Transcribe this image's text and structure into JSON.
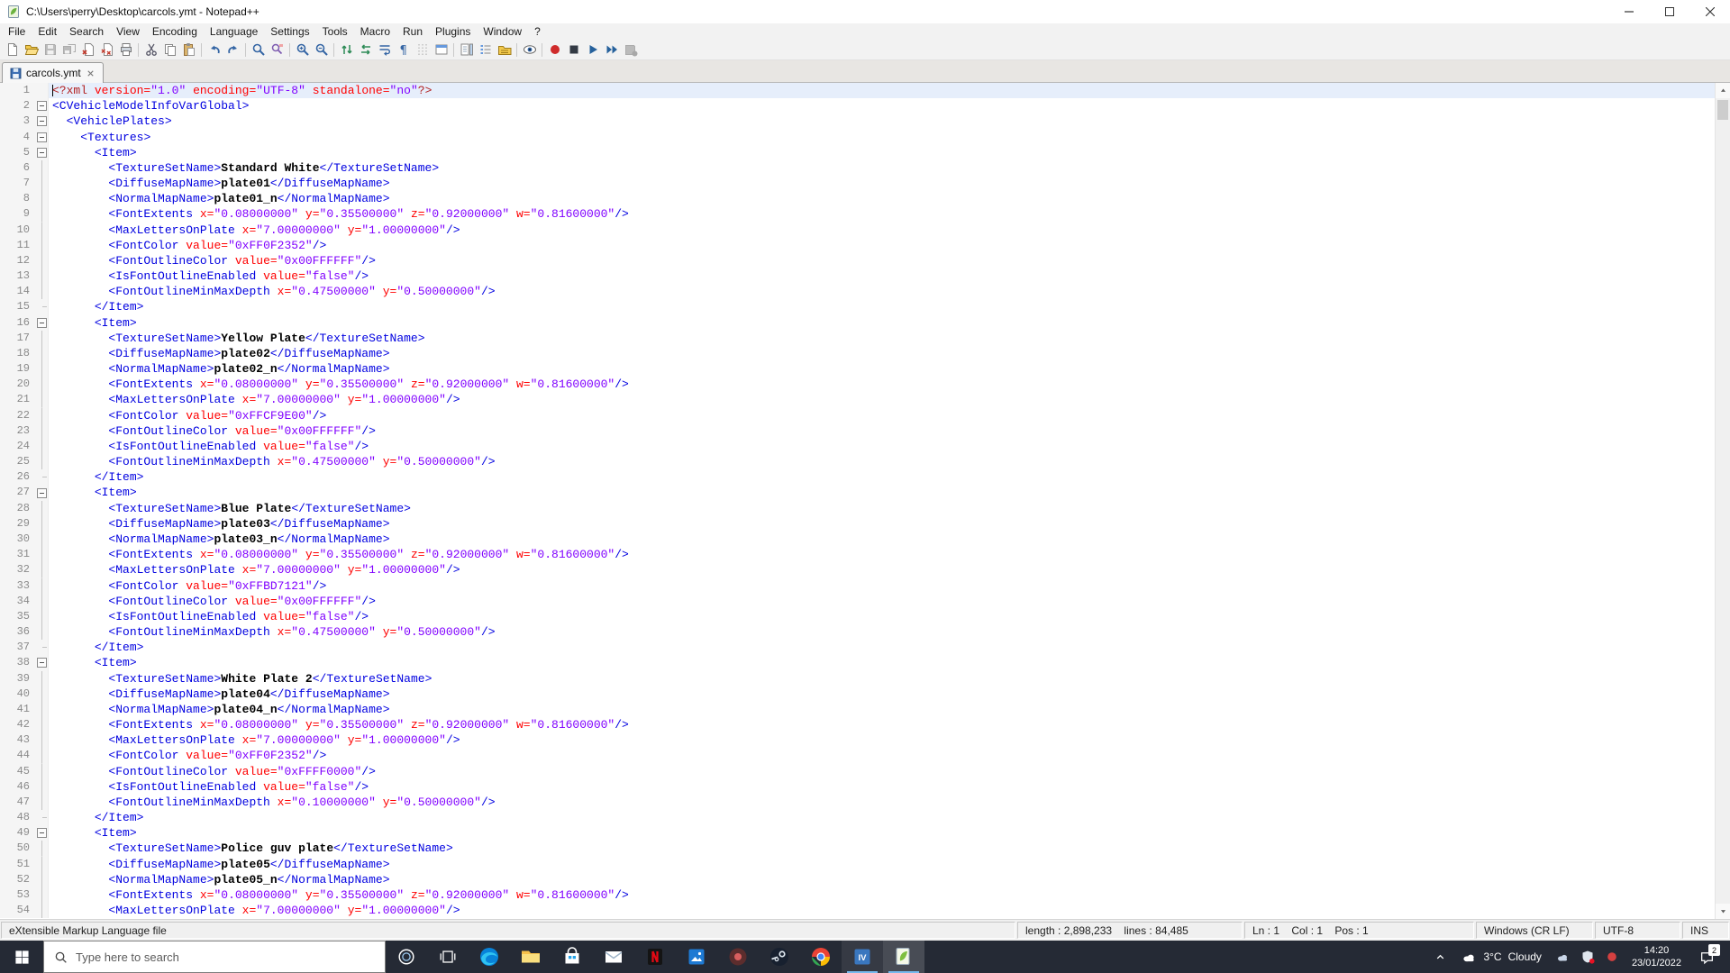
{
  "window": {
    "title": "C:\\Users\\perry\\Desktop\\carcols.ymt - Notepad++"
  },
  "menu": {
    "items": [
      "File",
      "Edit",
      "Search",
      "View",
      "Encoding",
      "Language",
      "Settings",
      "Tools",
      "Macro",
      "Run",
      "Plugins",
      "Window",
      "?"
    ]
  },
  "toolbar": {
    "items": [
      {
        "icon": "new-file",
        "name": "New"
      },
      {
        "icon": "open-folder",
        "name": "Open"
      },
      {
        "icon": "save",
        "name": "Save",
        "disabled": true
      },
      {
        "icon": "save-all",
        "name": "Save All",
        "disabled": true
      },
      {
        "icon": "close-file",
        "name": "Close"
      },
      {
        "icon": "close-all",
        "name": "Close All"
      },
      {
        "icon": "print",
        "name": "Print"
      },
      {
        "sep": true
      },
      {
        "icon": "cut",
        "name": "Cut"
      },
      {
        "icon": "copy",
        "name": "Copy"
      },
      {
        "icon": "paste",
        "name": "Paste"
      },
      {
        "sep": true
      },
      {
        "icon": "undo",
        "name": "Undo"
      },
      {
        "icon": "redo",
        "name": "Redo"
      },
      {
        "sep": true
      },
      {
        "icon": "find",
        "name": "Find"
      },
      {
        "icon": "replace",
        "name": "Replace"
      },
      {
        "sep": true
      },
      {
        "icon": "zoom-in",
        "name": "Zoom In"
      },
      {
        "icon": "zoom-out",
        "name": "Zoom Out"
      },
      {
        "sep": true
      },
      {
        "icon": "sync-v",
        "name": "Synchronize Vertical Scrolling"
      },
      {
        "icon": "sync-h",
        "name": "Synchronize Horizontal Scrolling"
      },
      {
        "icon": "word-wrap",
        "name": "Word Wrap"
      },
      {
        "icon": "show-all-chars",
        "name": "Show All Characters"
      },
      {
        "icon": "indent-guide",
        "name": "Show Indent Guide"
      },
      {
        "icon": "user-dialog",
        "name": "User-Defined Dialog"
      },
      {
        "sep": true
      },
      {
        "icon": "doc-map",
        "name": "Document Map"
      },
      {
        "icon": "function-list",
        "name": "Function List"
      },
      {
        "icon": "folder-workspace",
        "name": "Folder as Workspace"
      },
      {
        "sep": true
      },
      {
        "icon": "monitoring",
        "name": "Monitoring"
      },
      {
        "sep": true
      },
      {
        "icon": "macro-record",
        "name": "Start Recording"
      },
      {
        "icon": "macro-stop",
        "name": "Stop Recording"
      },
      {
        "icon": "macro-play",
        "name": "Playback"
      },
      {
        "icon": "macro-run-multiple",
        "name": "Run Macro Multiple Times"
      },
      {
        "icon": "macro-save",
        "name": "Save Recorded Macro",
        "disabled": true
      }
    ]
  },
  "tabs": [
    {
      "label": "carcols.ymt",
      "active": true,
      "saved": true
    }
  ],
  "editor": {
    "current_line": 1,
    "colors": {
      "tag": "#0000E0",
      "attr": "#FF0000",
      "value": "#8000FF",
      "pi": "#B22222",
      "text": "#000000",
      "current_line_bg": "#E6EEFB"
    },
    "fold_boxes": [
      2,
      3,
      4,
      5,
      16,
      27,
      38,
      49
    ],
    "fold_ends": [
      15,
      26,
      37,
      48
    ],
    "lines": [
      "<?xml version=\"1.0\" encoding=\"UTF-8\" standalone=\"no\"?>",
      "<CVehicleModelInfoVarGlobal>",
      "  <VehiclePlates>",
      "    <Textures>",
      "      <Item>",
      "        <TextureSetName>Standard White</TextureSetName>",
      "        <DiffuseMapName>plate01</DiffuseMapName>",
      "        <NormalMapName>plate01_n</NormalMapName>",
      "        <FontExtents x=\"0.08000000\" y=\"0.35500000\" z=\"0.92000000\" w=\"0.81600000\"/>",
      "        <MaxLettersOnPlate x=\"7.00000000\" y=\"1.00000000\"/>",
      "        <FontColor value=\"0xFF0F2352\"/>",
      "        <FontOutlineColor value=\"0x00FFFFFF\"/>",
      "        <IsFontOutlineEnabled value=\"false\"/>",
      "        <FontOutlineMinMaxDepth x=\"0.47500000\" y=\"0.50000000\"/>",
      "      </Item>",
      "      <Item>",
      "        <TextureSetName>Yellow Plate</TextureSetName>",
      "        <DiffuseMapName>plate02</DiffuseMapName>",
      "        <NormalMapName>plate02_n</NormalMapName>",
      "        <FontExtents x=\"0.08000000\" y=\"0.35500000\" z=\"0.92000000\" w=\"0.81600000\"/>",
      "        <MaxLettersOnPlate x=\"7.00000000\" y=\"1.00000000\"/>",
      "        <FontColor value=\"0xFFCF9E00\"/>",
      "        <FontOutlineColor value=\"0x00FFFFFF\"/>",
      "        <IsFontOutlineEnabled value=\"false\"/>",
      "        <FontOutlineMinMaxDepth x=\"0.47500000\" y=\"0.50000000\"/>",
      "      </Item>",
      "      <Item>",
      "        <TextureSetName>Blue Plate</TextureSetName>",
      "        <DiffuseMapName>plate03</DiffuseMapName>",
      "        <NormalMapName>plate03_n</NormalMapName>",
      "        <FontExtents x=\"0.08000000\" y=\"0.35500000\" z=\"0.92000000\" w=\"0.81600000\"/>",
      "        <MaxLettersOnPlate x=\"7.00000000\" y=\"1.00000000\"/>",
      "        <FontColor value=\"0xFFBD7121\"/>",
      "        <FontOutlineColor value=\"0x00FFFFFF\"/>",
      "        <IsFontOutlineEnabled value=\"false\"/>",
      "        <FontOutlineMinMaxDepth x=\"0.47500000\" y=\"0.50000000\"/>",
      "      </Item>",
      "      <Item>",
      "        <TextureSetName>White Plate 2</TextureSetName>",
      "        <DiffuseMapName>plate04</DiffuseMapName>",
      "        <NormalMapName>plate04_n</NormalMapName>",
      "        <FontExtents x=\"0.08000000\" y=\"0.35500000\" z=\"0.92000000\" w=\"0.81600000\"/>",
      "        <MaxLettersOnPlate x=\"7.00000000\" y=\"1.00000000\"/>",
      "        <FontColor value=\"0xFF0F2352\"/>",
      "        <FontOutlineColor value=\"0xFFFF0000\"/>",
      "        <IsFontOutlineEnabled value=\"false\"/>",
      "        <FontOutlineMinMaxDepth x=\"0.10000000\" y=\"0.50000000\"/>",
      "      </Item>",
      "      <Item>",
      "        <TextureSetName>Police guv plate</TextureSetName>",
      "        <DiffuseMapName>plate05</DiffuseMapName>",
      "        <NormalMapName>plate05_n</NormalMapName>",
      "        <FontExtents x=\"0.08000000\" y=\"0.35500000\" z=\"0.92000000\" w=\"0.81600000\"/>",
      "        <MaxLettersOnPlate x=\"7.00000000\" y=\"1.00000000\"/>"
    ]
  },
  "status_bar": {
    "doc_type": "eXtensible Markup Language file",
    "length_lines": "length : 2,898,233    lines : 84,485",
    "position": "Ln : 1    Col : 1    Pos : 1",
    "eol": "Windows (CR LF)",
    "encoding": "UTF-8",
    "mode": "INS"
  },
  "taskbar": {
    "search": {
      "placeholder": "Type here to search"
    },
    "apps": [
      {
        "name": "edge"
      },
      {
        "name": "file-explorer"
      },
      {
        "name": "microsoft-store"
      },
      {
        "name": "mail"
      },
      {
        "name": "app-red"
      },
      {
        "name": "app-photos"
      },
      {
        "name": "app-dark"
      },
      {
        "name": "steam"
      },
      {
        "name": "chrome"
      },
      {
        "name": "openiv",
        "running": true,
        "label": "IV"
      },
      {
        "name": "notepad-plus-plus",
        "active": true
      }
    ],
    "tray": {
      "weather": {
        "temp": "3°C",
        "condition": "Cloudy"
      },
      "time": "14:20",
      "date": "23/01/2022",
      "notification_count": "2"
    }
  }
}
